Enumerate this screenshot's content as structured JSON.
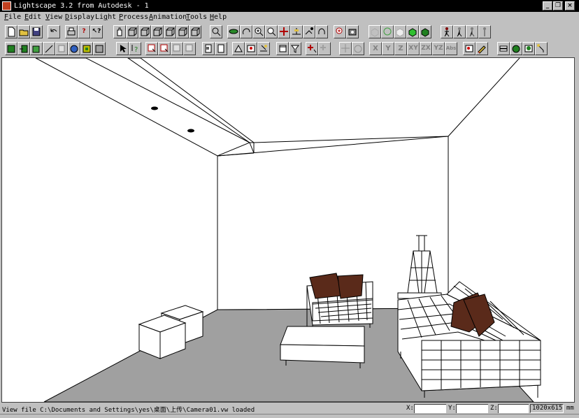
{
  "window": {
    "title": "Lightscape 3.2 from Autodesk - 1",
    "controls": [
      "minimize",
      "restore",
      "close"
    ]
  },
  "menu": [
    {
      "hotkey": "F",
      "rest": "ile"
    },
    {
      "hotkey": "E",
      "rest": "dit"
    },
    {
      "hotkey": "V",
      "rest": "iew"
    },
    {
      "hotkey": "D",
      "rest": "isplay"
    },
    {
      "pre": "Li",
      "hotkey": "g",
      "rest": "ht"
    },
    {
      "hotkey": "P",
      "rest": "rocess"
    },
    {
      "hotkey": "A",
      "rest": "nimation"
    },
    {
      "hotkey": "T",
      "rest": "ools"
    },
    {
      "hotkey": "H",
      "rest": "elp"
    }
  ],
  "toolbar_axis_buttons": [
    "X",
    "Y",
    "Z",
    "XY",
    "ZX",
    "YZ",
    "Abs"
  ],
  "status": {
    "message": "View file C:\\Documents and Settings\\yes\\桌面\\上传\\Camera01.vw loaded",
    "x_label": "X:",
    "y_label": "Y:",
    "z_label": "Z:",
    "resolution": "1020x615",
    "unit": "mm"
  },
  "colors": {
    "title_bg": "#000000",
    "chrome": "#c0c0c0",
    "floor": "#a0a0a0",
    "cushion": "#5a2a1a",
    "viewport_bg": "#ffffff"
  }
}
